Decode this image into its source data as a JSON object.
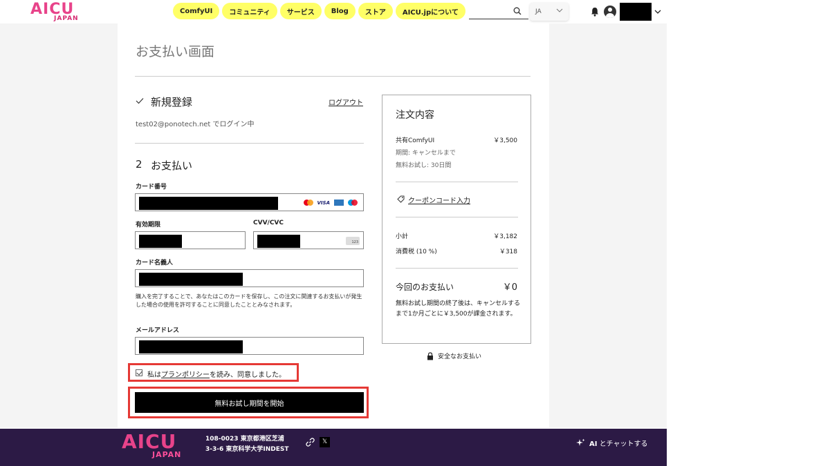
{
  "header": {
    "logo_main": "AICU",
    "logo_sub": "JAPAN",
    "nav": [
      "ComfyUI",
      "コミュニティ",
      "サービス",
      "Blog",
      "ストア",
      "AICU.jpについて"
    ],
    "lang": "JA"
  },
  "checkout": {
    "title": "お支払い画面",
    "step1": {
      "title": "新規登録",
      "logout": "ログアウト",
      "status": "test02@ponotech.net でログイン中"
    },
    "step2": {
      "number": "2",
      "title": "お支払い"
    },
    "fields": {
      "card_number_label": "カード番号",
      "expiry_label": "有効期限",
      "cvv_label": "CVV/CVC",
      "cardholder_label": "カード名義人",
      "email_label": "メールアドレス"
    },
    "card_logos": {
      "visa": "VISA",
      "cvv_hint": "123"
    },
    "consent_note": "購入を完了することで、あなたはこのカードを保存し、この注文に関連するお支払いが発生した場合の使用を許可することに同意したこととみなされます。",
    "agree": {
      "prefix": "私は",
      "link": "プランポリシー",
      "suffix": "を読み、同意しました。"
    },
    "start_button": "無料お試し期間を開始"
  },
  "summary": {
    "title": "注文内容",
    "item_name": "共有ComfyUI",
    "item_price": "￥3,500",
    "period": "期間: キャンセルまで",
    "trial": "無料お試し: 30日間",
    "coupon": "クーポンコード入力",
    "subtotal_label": "小計",
    "subtotal": "￥3,182",
    "tax_label": "消費税 (10 %)",
    "tax": "￥318",
    "total_label": "今回のお支払い",
    "total": "￥0",
    "note": "無料お試し期間の終了後は、キャンセルするまで1か月ごとに￥3,500が課金されます。",
    "secure": "安全なお支払い"
  },
  "footer": {
    "logo_main": "AICU",
    "logo_sub": "JAPAN",
    "address_line1": "108-0023 東京都港区芝浦",
    "address_line2": "3-3-6 東京科学大学INDEST",
    "x_label": "𝕏",
    "ai_chat_bold": "AI",
    "ai_chat_rest": "とチャットする"
  }
}
